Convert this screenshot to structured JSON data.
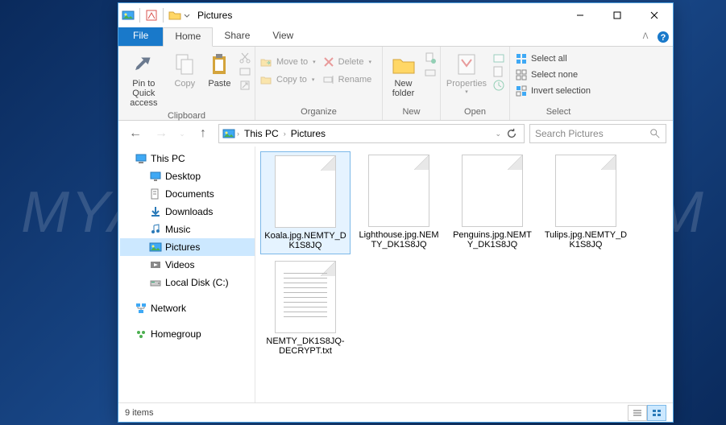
{
  "watermark": "MYANTISPYWARE.COM",
  "title": "Pictures",
  "tabs": {
    "file": "File",
    "home": "Home",
    "share": "Share",
    "view": "View"
  },
  "ribbon": {
    "clipboard": {
      "label": "Clipboard",
      "pin": "Pin to Quick access",
      "copy": "Copy",
      "paste": "Paste"
    },
    "organize": {
      "label": "Organize",
      "moveto": "Move to",
      "copyto": "Copy to",
      "delete": "Delete",
      "rename": "Rename"
    },
    "new": {
      "label": "New",
      "newfolder": "New folder"
    },
    "open": {
      "label": "Open",
      "properties": "Properties"
    },
    "select": {
      "label": "Select",
      "all": "Select all",
      "none": "Select none",
      "invert": "Invert selection"
    }
  },
  "breadcrumb": {
    "root": "This PC",
    "folder": "Pictures"
  },
  "search_placeholder": "Search Pictures",
  "tree": {
    "thispc": "This PC",
    "desktop": "Desktop",
    "documents": "Documents",
    "downloads": "Downloads",
    "music": "Music",
    "pictures": "Pictures",
    "videos": "Videos",
    "localdisk": "Local Disk (C:)",
    "network": "Network",
    "homegroup": "Homegroup"
  },
  "files": [
    {
      "name": "Koala.jpg.NEMTY_DK1S8JQ",
      "type": "file",
      "selected": true
    },
    {
      "name": "Lighthouse.jpg.NEMTY_DK1S8JQ",
      "type": "file",
      "selected": false
    },
    {
      "name": "Penguins.jpg.NEMTY_DK1S8JQ",
      "type": "file",
      "selected": false
    },
    {
      "name": "Tulips.jpg.NEMTY_DK1S8JQ",
      "type": "file",
      "selected": false
    },
    {
      "name": "NEMTY_DK1S8JQ-DECRYPT.txt",
      "type": "txt",
      "selected": false
    }
  ],
  "status": "9 items"
}
